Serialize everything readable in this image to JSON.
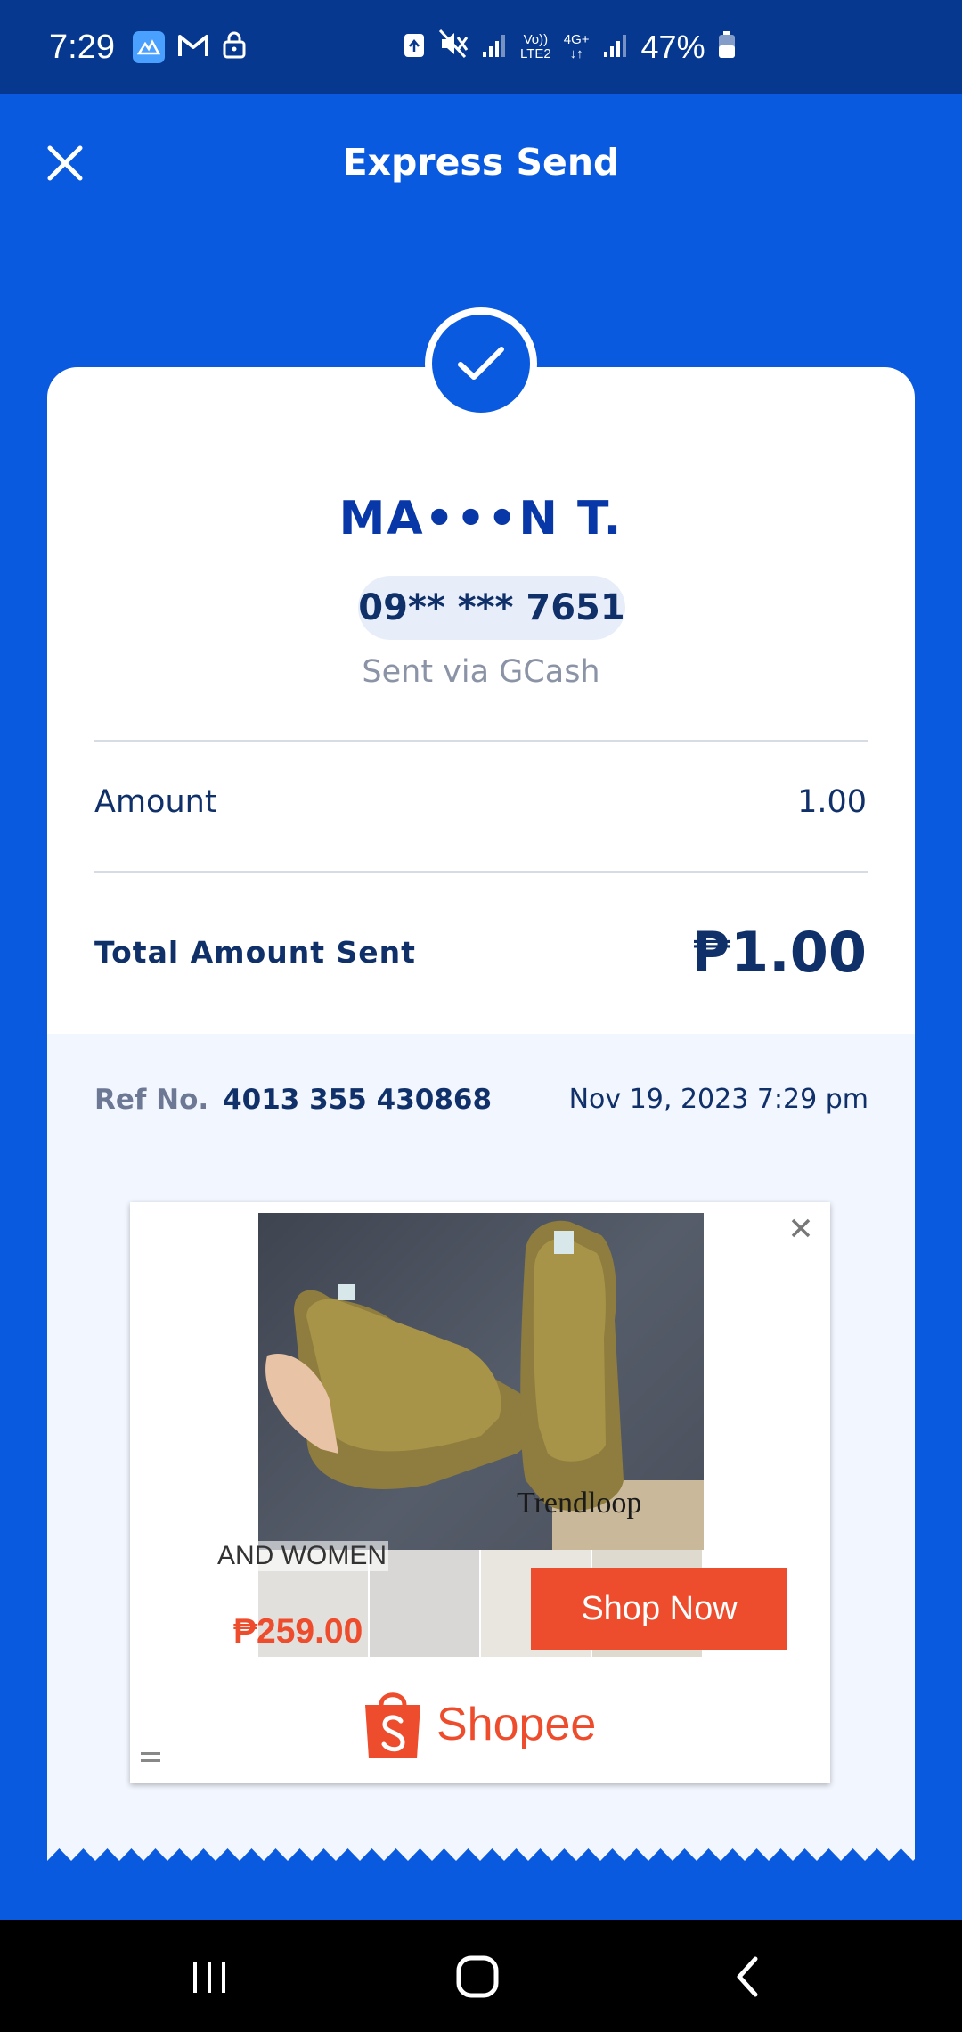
{
  "status_bar": {
    "time": "7:29",
    "network_top": "Vo))",
    "network_bottom": "LTE2",
    "data_top": "4G+",
    "battery": "47%",
    "icons": [
      "gallery-icon",
      "gmail-icon",
      "lock-icon",
      "recycle-icon",
      "mute-icon",
      "signal-icon",
      "signal-icon-2",
      "battery-icon"
    ]
  },
  "header": {
    "title": "Express Send",
    "close_icon": "close-icon"
  },
  "receipt": {
    "recipient_name": "MA•••N T.",
    "phone": "09** *** 7651",
    "sent_via": "Sent via GCash",
    "amount_label": "Amount",
    "amount_value": "1.00",
    "total_label": "Total Amount Sent",
    "total_value": "₱1.00",
    "ref_label": "Ref No.",
    "ref_number": "4013 355 430868",
    "date": "Nov 19, 2023 7:29 pm"
  },
  "ad": {
    "caption": "AND WOMEN",
    "price": "₱259.00",
    "cta": "Shop Now",
    "brand": "Shopee",
    "watermark": "Trendloop",
    "brand_color": "#ee4d2d"
  },
  "colors": {
    "primary": "#0a5ae0",
    "status_bar": "#063890",
    "text_dark": "#10306a",
    "name_blue": "#0837a8"
  }
}
